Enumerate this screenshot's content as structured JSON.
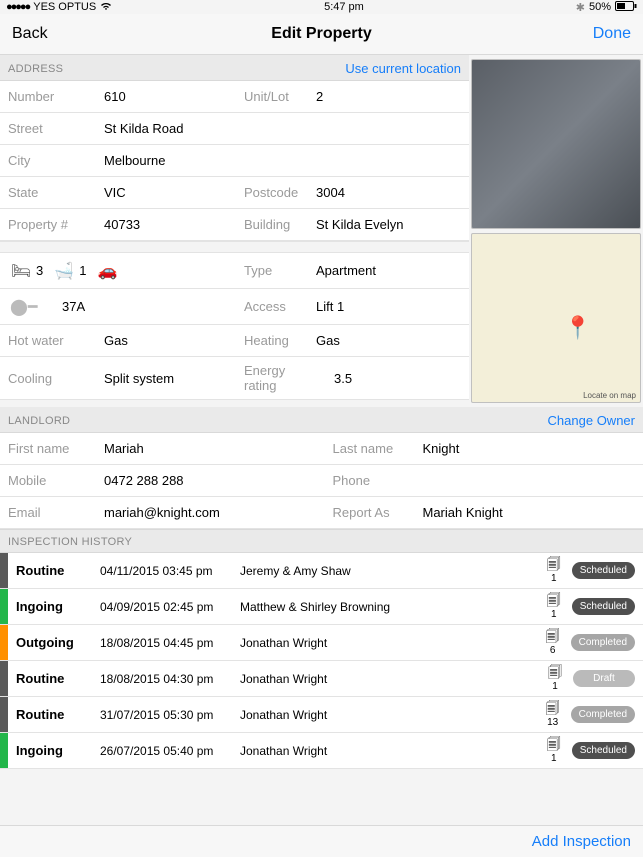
{
  "status": {
    "carrier": "YES OPTUS",
    "time": "5:47 pm",
    "bluetooth": "✱",
    "battery": "50%"
  },
  "nav": {
    "back": "Back",
    "title": "Edit Property",
    "done": "Done"
  },
  "address": {
    "section": "ADDRESS",
    "action": "Use current location",
    "fields": {
      "number_label": "Number",
      "number": "610",
      "unit_label": "Unit/Lot",
      "unit": "2",
      "street_label": "Street",
      "street": "St Kilda Road",
      "city_label": "City",
      "city": "Melbourne",
      "state_label": "State",
      "state": "VIC",
      "postcode_label": "Postcode",
      "postcode": "3004",
      "propnum_label": "Property #",
      "propnum": "40733",
      "building_label": "Building",
      "building": "St Kilda Evelyn"
    }
  },
  "features": {
    "beds": "3",
    "baths": "1",
    "cars": "",
    "type_label": "Type",
    "type": "Apartment",
    "key": "37A",
    "access_label": "Access",
    "access": "Lift 1",
    "hotwater_label": "Hot water",
    "hotwater": "Gas",
    "heating_label": "Heating",
    "heating": "Gas",
    "cooling_label": "Cooling",
    "cooling": "Split system",
    "energy_label": "Energy rating",
    "energy": "3.5"
  },
  "landlord": {
    "section": "LANDLORD",
    "action": "Change Owner",
    "first_label": "First name",
    "first": "Mariah",
    "last_label": "Last name",
    "last": "Knight",
    "mobile_label": "Mobile",
    "mobile": "0472 288 288",
    "phone_label": "Phone",
    "phone": "",
    "email_label": "Email",
    "email": "mariah@knight.com",
    "report_label": "Report As",
    "report": "Mariah Knight"
  },
  "history": {
    "section": "INSPECTION HISTORY",
    "rows": [
      {
        "stripe": "grey",
        "type": "Routine",
        "date": "04/11/2015 03:45 pm",
        "name": "Jeremy & Amy Shaw",
        "count": "1",
        "badge": "Scheduled",
        "bclass": "sched"
      },
      {
        "stripe": "green",
        "type": "Ingoing",
        "date": "04/09/2015 02:45 pm",
        "name": "Matthew & Shirley Browning",
        "count": "1",
        "badge": "Scheduled",
        "bclass": "sched"
      },
      {
        "stripe": "orange",
        "type": "Outgoing",
        "date": "18/08/2015 04:45 pm",
        "name": "Jonathan Wright",
        "count": "6",
        "badge": "Completed",
        "bclass": "comp"
      },
      {
        "stripe": "grey",
        "type": "Routine",
        "date": "18/08/2015 04:30 pm",
        "name": "Jonathan Wright",
        "count": "1",
        "badge": "Draft",
        "bclass": "draft"
      },
      {
        "stripe": "grey",
        "type": "Routine",
        "date": "31/07/2015 05:30 pm",
        "name": "Jonathan Wright",
        "count": "13",
        "badge": "Completed",
        "bclass": "comp"
      },
      {
        "stripe": "green",
        "type": "Ingoing",
        "date": "26/07/2015 05:40 pm",
        "name": "Jonathan Wright",
        "count": "1",
        "badge": "Scheduled",
        "bclass": "sched"
      }
    ]
  },
  "footer": {
    "add": "Add Inspection"
  },
  "map": {
    "locate": "Locate on map"
  }
}
